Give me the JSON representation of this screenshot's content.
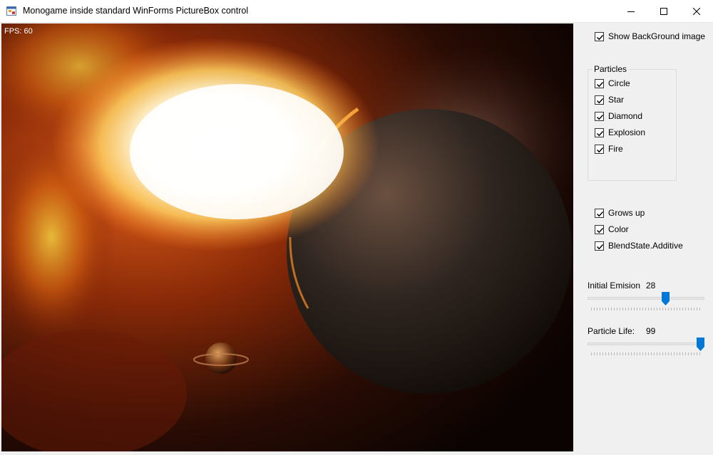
{
  "window": {
    "title": "Monogame inside standard WinForms PictureBox control",
    "icons": {
      "app": "winforms-app-icon",
      "minimize": "minimize-icon",
      "maximize": "maximize-icon",
      "close": "close-icon"
    }
  },
  "canvas": {
    "fps_label": "FPS: 60",
    "scene": "space-nebula-with-planets"
  },
  "options": {
    "show_background": {
      "label": "Show BackGround image",
      "checked": true
    }
  },
  "particles_group": {
    "title": "Particles",
    "items": [
      {
        "label": "Circle",
        "checked": true
      },
      {
        "label": "Star",
        "checked": true
      },
      {
        "label": "Diamond",
        "checked": true
      },
      {
        "label": "Explosion",
        "checked": true
      },
      {
        "label": "Fire",
        "checked": true
      }
    ]
  },
  "effects": [
    {
      "label": "Grows up",
      "checked": true
    },
    {
      "label": "Color",
      "checked": true
    },
    {
      "label": "BlendState.Additive",
      "checked": true
    }
  ],
  "sliders": {
    "initial_emission": {
      "label": "Initial Emision",
      "value": "28",
      "fraction": 0.67
    },
    "particle_life": {
      "label": "Particle Life:",
      "value": "99",
      "fraction": 1.0
    }
  },
  "colors": {
    "accent": "#0078d7",
    "window_bg": "#f0f0f0",
    "titlebar_bg": "#ffffff"
  }
}
